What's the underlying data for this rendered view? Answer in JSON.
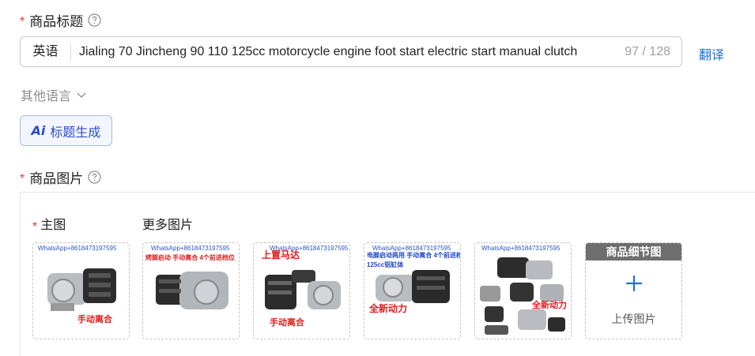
{
  "title_section": {
    "required_mark": "*",
    "label": "商品标题",
    "language_prefix": "英语",
    "value": "Jialing 70 Jincheng 90 110 125cc motorcycle engine foot start electric start manual clutch",
    "char_count": "97 / 128",
    "translate_label": "翻译",
    "other_languages_label": "其他语言",
    "ai_button_mark": "Ai",
    "ai_button_label": "标题生成"
  },
  "image_section": {
    "required_mark": "*",
    "label": "商品图片",
    "main_image_required_mark": "*",
    "main_image_label": "主图",
    "more_images_label": "更多图片",
    "thumbnails": [
      {
        "watermark": "WhatsApp+8618473197595",
        "texts": [
          {
            "text": "手动离合",
            "style": "red"
          }
        ]
      },
      {
        "watermark": "WhatsApp+8618473197595",
        "texts": [
          {
            "text": "烤脚启动  手动离合  4个前进档位",
            "style": "red"
          }
        ]
      },
      {
        "watermark": "WhatsApp+8618473197595",
        "texts": [
          {
            "text": "上置马达",
            "style": "red"
          },
          {
            "text": "手动离合",
            "style": "red"
          }
        ]
      },
      {
        "watermark": "WhatsApp+8618473197595",
        "texts": [
          {
            "text": "电脚启动两用  手动离合  4个前进档位",
            "style": "blue"
          },
          {
            "text": "125cc铝缸体",
            "style": "blue"
          },
          {
            "text": "全新动力",
            "style": "red"
          }
        ]
      },
      {
        "watermark": "WhatsApp+8618473197595",
        "texts": [
          {
            "text": "全新动力",
            "style": "red"
          }
        ]
      }
    ],
    "detail_slot_header": "商品细节图",
    "upload_label": "上传图片"
  },
  "colors": {
    "required": "#e0393e",
    "link": "#1a6fe0",
    "ai_button_text": "#2d4ec9",
    "muted": "#8c8c8c"
  },
  "icons": {
    "help": "question-circle-icon",
    "chevron": "chevron-down-icon",
    "plus": "plus-icon"
  }
}
